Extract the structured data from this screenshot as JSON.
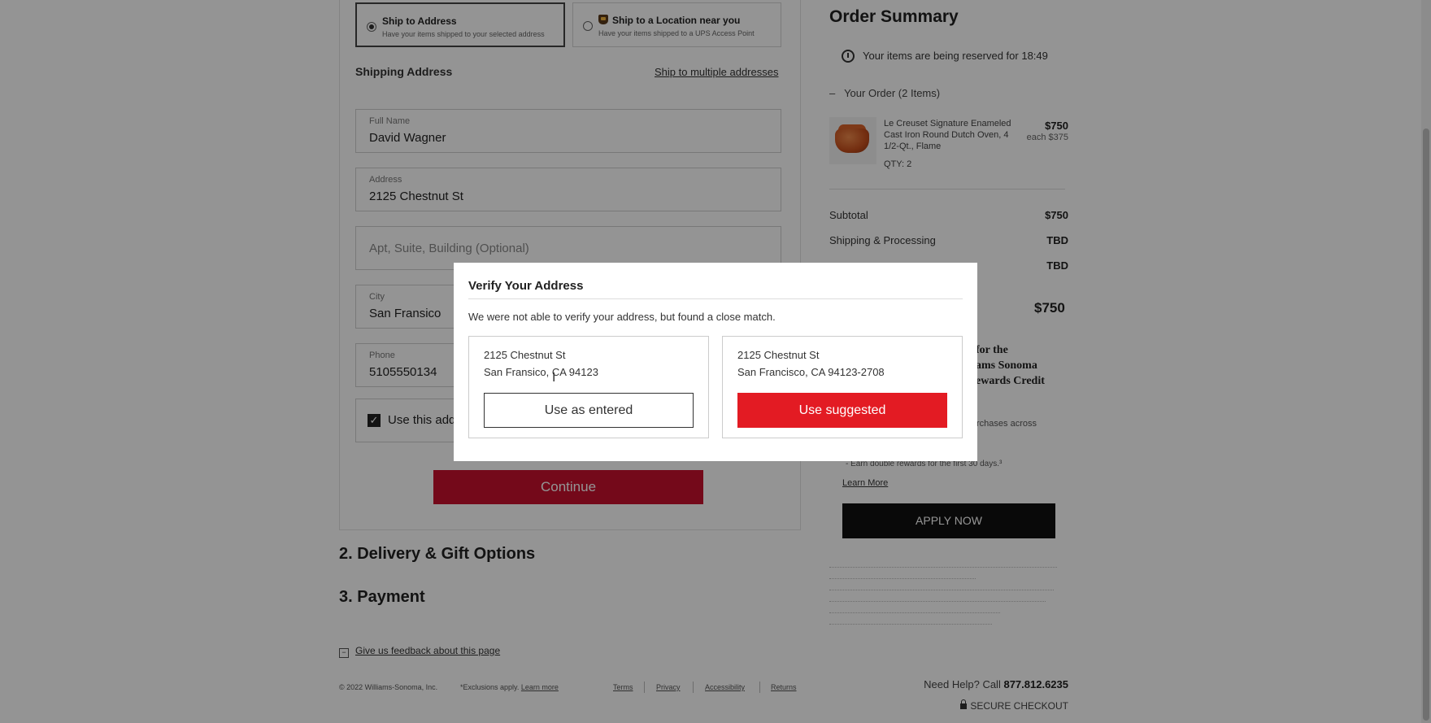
{
  "shipping_options": [
    {
      "title": "Ship to Address",
      "subtitle": "Have your items shipped to your selected address",
      "selected": true
    },
    {
      "title": "Ship to a Location near you",
      "subtitle": "Have your items shipped to a UPS Access Point",
      "selected": false,
      "icon": "ups-icon"
    }
  ],
  "shipping_address": {
    "heading": "Shipping Address",
    "multi_link": "Ship to multiple addresses",
    "full_name_label": "Full Name",
    "full_name_value": "David Wagner",
    "address_label": "Address",
    "address_value": "2125 Chestnut St",
    "apt_placeholder": "Apt, Suite, Building (Optional)",
    "city_label": "City",
    "city_value": "San Fransico",
    "phone_label": "Phone",
    "phone_value": "5105550134",
    "checkbox_label": "Use this add",
    "checkbox_checked": true
  },
  "continue_label": "Continue",
  "steps": {
    "delivery": "2. Delivery & Gift Options",
    "payment": "3. Payment"
  },
  "feedback": {
    "icon": "[-]",
    "label": "Give us feedback about this page"
  },
  "footer": {
    "copyright": "© 2022 Williams-Sonoma, Inc.",
    "exclusions": "*Exclusions apply.",
    "exclusions_link": "Learn more",
    "links": [
      "Terms",
      "Privacy",
      "Accessibility",
      "Returns"
    ]
  },
  "summary": {
    "title": "Order Summary",
    "reserved": "Your items are being reserved for 18:49",
    "your_order_toggle": "–",
    "your_order": "Your Order (2 Items)",
    "product": {
      "name": "Le Creuset Signature Enameled Cast Iron Round Dutch Oven, 4 1/2-Qt., Flame",
      "qty": "QTY: 2",
      "price": "$750",
      "each": "each $375"
    },
    "rows": [
      {
        "label": "Subtotal",
        "value": "$750"
      },
      {
        "label": "Shipping & Processing",
        "value": "TBD"
      },
      {
        "label": "",
        "value": "TBD"
      }
    ],
    "total": "$750",
    "promo_heading": "for the\nams Sonoma\newards Credit",
    "promo_lines": [
      "rchases across",
      "- Earn double rewards for the first 30 days.³"
    ],
    "learn_more": "Learn More",
    "apply_now": "APPLY NOW",
    "need_help_prefix": "Need Help? Call",
    "phone": "877.812.6235",
    "secure": "SECURE CHECKOUT"
  },
  "modal": {
    "title": "Verify Your Address",
    "message": "We were not able to verify your address, but found a close match.",
    "entered": {
      "line1": "2125 Chestnut St",
      "line2": "San Fransico, CA 94123",
      "button": "Use as entered"
    },
    "suggested": {
      "line1": "2125 Chestnut St",
      "line2": "San Francisco, CA 94123-2708",
      "button": "Use suggested"
    }
  },
  "colors": {
    "brand_red": "#e31b23",
    "continue_red": "#c8102e",
    "apply_black": "#111111"
  }
}
